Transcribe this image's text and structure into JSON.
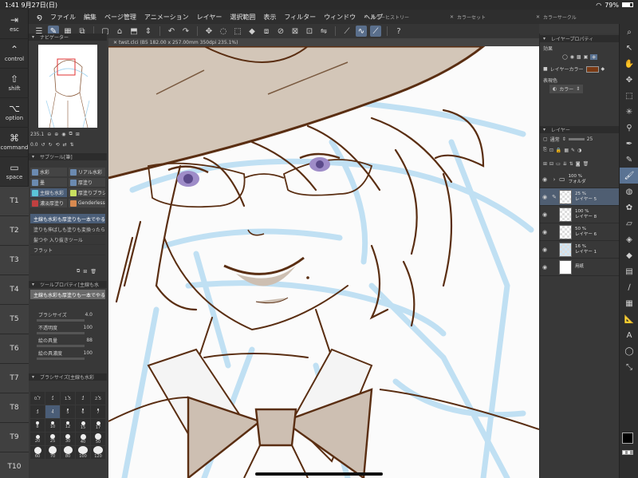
{
  "status": {
    "time": "1:41",
    "date": "9月27日(日)",
    "battery": "79%"
  },
  "menu": [
    "ファイル",
    "編集",
    "ページ管理",
    "アニメーション",
    "レイヤー",
    "選択範囲",
    "表示",
    "フィルター",
    "ウィンドウ",
    "ヘルプ"
  ],
  "float_tabs": {
    "color_history": "カラーヒストリー",
    "color_set": "カラーセット",
    "color_circle": "カラーサークル"
  },
  "edge_keys": [
    {
      "glyph": "⇥",
      "label": "esc"
    },
    {
      "glyph": "⌃",
      "label": "control"
    },
    {
      "glyph": "⇧",
      "label": "shift"
    },
    {
      "glyph": "⌥",
      "label": "option"
    },
    {
      "glyph": "⌘",
      "label": "command"
    },
    {
      "glyph": "▭",
      "label": "space"
    }
  ],
  "t_keys": [
    "T1",
    "T2",
    "T3",
    "T4",
    "T5",
    "T6",
    "T7",
    "T8",
    "T9",
    "T10"
  ],
  "canvas_tab": "twst.clci (B5 182.00 x 257.00mm 350dpi 235.1%)",
  "navigator": {
    "title": "ナビゲーター",
    "zoom": "235.1",
    "angle": "0.0"
  },
  "subtool": {
    "title": "サブツール[筆]",
    "grid": [
      [
        "水彩",
        "リアル水彩"
      ],
      [
        "墨",
        "厚塗り"
      ],
      [
        "主線も水彩",
        "厚塗りブラシ"
      ],
      [
        "濃淡厚塗り",
        "Genderless"
      ]
    ],
    "list": [
      "主線も水彩も厚塗りも一本でやる",
      "塗りも伸ばしも塗りも変換ったら",
      "髪つや 入り抜きツール",
      "フラット"
    ]
  },
  "tool_property": {
    "title": "ツールプロパティ[主線も水",
    "selected": "主線も水彩も厚塗りも一本でやる主線のブラ",
    "rows": [
      {
        "label": "ブラシサイズ",
        "value": "4.0"
      },
      {
        "label": "不透明度",
        "value": "100"
      },
      {
        "label": "絵の具量",
        "value": "88"
      },
      {
        "label": "絵の具濃度",
        "value": "100"
      }
    ]
  },
  "brush_size": {
    "title": "ブラシサイズ[主線も水彩",
    "values": [
      "0.7",
      "1",
      "1.5",
      "2",
      "2.5",
      "3",
      "4",
      "5",
      "6",
      "7",
      "8",
      "10",
      "12",
      "15",
      "17",
      "20",
      "25",
      "30",
      "40",
      "50",
      "60",
      "70",
      "80",
      "100",
      "120"
    ],
    "selected": "4"
  },
  "layer_property": {
    "title": "レイヤープロパティ",
    "effect": "効果",
    "layer_color": "レイヤーカラー",
    "expression_color": "表現色",
    "expression_value": "カラー"
  },
  "layer_panel": {
    "title": "レイヤー",
    "blend": "通常",
    "opacity": "25",
    "layers": [
      {
        "pct": "100 %",
        "name": "フォルダ",
        "kind": "folder"
      },
      {
        "pct": "25 %",
        "name": "レイヤー 5",
        "kind": "layer",
        "selected": true
      },
      {
        "pct": "100 %",
        "name": "レイヤー 8",
        "kind": "layer"
      },
      {
        "pct": "50 %",
        "name": "レイヤー 6",
        "kind": "layer"
      },
      {
        "pct": "16 %",
        "name": "レイヤー 1",
        "kind": "layer"
      },
      {
        "pct": "",
        "name": "用紙",
        "kind": "paper"
      }
    ]
  },
  "colors": {
    "accent": "#5a7393",
    "line": "#5a2e12",
    "sketch": "#a9d6f0",
    "hat": "#cfc2b4",
    "main": "#000000",
    "sub": "#ffffff"
  }
}
